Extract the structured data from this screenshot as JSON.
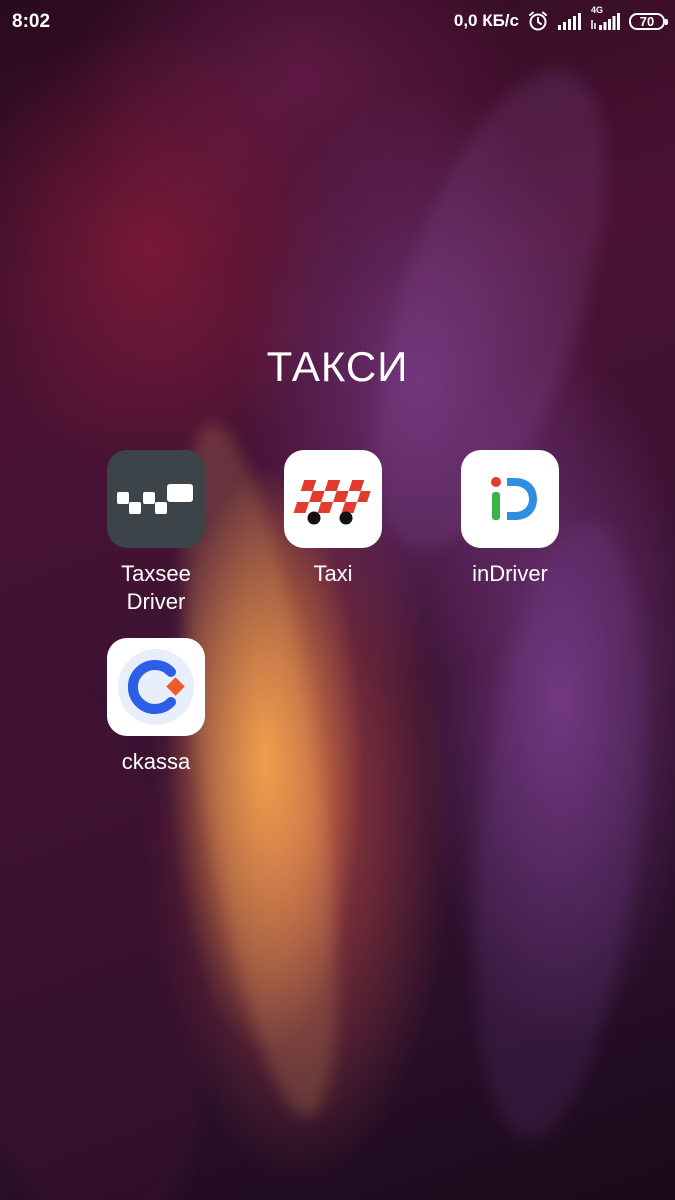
{
  "status_bar": {
    "time": "8:02",
    "network_speed": "0,0 КБ/с",
    "network_type": "4G",
    "battery": "70",
    "icons": [
      "alarm-icon",
      "signal-icon",
      "signal-4g-icon",
      "battery-icon"
    ]
  },
  "folder": {
    "title": "ТАКСИ",
    "apps": [
      {
        "label": "Taxsee Driver",
        "icon": "taxsee-driver-icon",
        "color": "#3c4349"
      },
      {
        "label": "Taxi",
        "icon": "taxi-icon",
        "color": "#e23b2e"
      },
      {
        "label": "inDriver",
        "icon": "indriver-icon",
        "color": "#2e8fe0"
      },
      {
        "label": "ckassa",
        "icon": "ckassa-icon",
        "color": "#2c5ee8"
      }
    ]
  }
}
